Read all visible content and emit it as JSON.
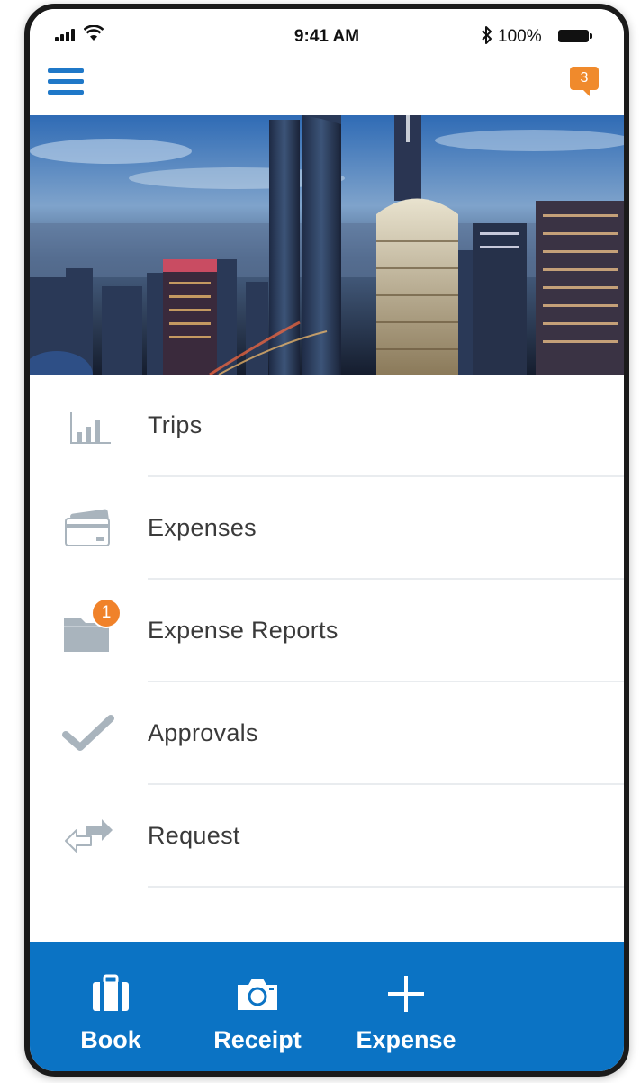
{
  "status_bar": {
    "time": "9:41 AM",
    "battery": "100%"
  },
  "header": {
    "menu_icon": "hamburger-icon",
    "notification_count": "3"
  },
  "hero": {
    "icon": "city-skyline-image"
  },
  "menu": {
    "items": [
      {
        "label": "Trips",
        "icon": "bar-chart-icon"
      },
      {
        "label": "Expenses",
        "icon": "credit-card-icon"
      },
      {
        "label": "Expense Reports",
        "icon": "folder-icon",
        "badge": "1"
      },
      {
        "label": "Approvals",
        "icon": "checkmark-icon"
      },
      {
        "label": "Request",
        "icon": "arrows-icon"
      }
    ]
  },
  "bottom_bar": {
    "tabs": [
      {
        "label": "Book",
        "icon": "briefcase-icon"
      },
      {
        "label": "Receipt",
        "icon": "camera-icon"
      },
      {
        "label": "Expense",
        "icon": "plus-icon"
      }
    ]
  },
  "colors": {
    "primary": "#0b73c4",
    "accent": "#f0822a",
    "icon_gray": "#a9b4bd",
    "text": "#3a3a3a"
  }
}
